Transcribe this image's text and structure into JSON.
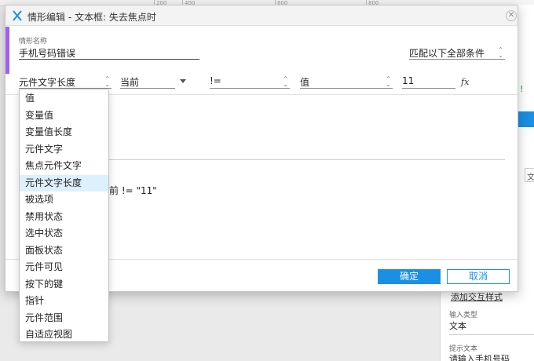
{
  "background": {
    "ruler_ticks": [
      "200",
      "400",
      "600",
      "800"
    ],
    "right_panel": {
      "link_text": "添加交互样式",
      "input_type_label": "输入类型",
      "input_type_value": "文本",
      "hint_label": "提示文本",
      "hint_value": "请输入手机号码",
      "partial_green_text": "!",
      "partial_tab_text": "文"
    }
  },
  "dialog": {
    "app_icon": "axure-logo-icon",
    "title": "情形编辑  -  文本框: 失去焦点时",
    "close_icon": "close-icon",
    "case_name_label": "情形名称",
    "case_name_value": "手机号码错误",
    "match_select_value": "匹配以下全部条件",
    "condition": {
      "target_value": "元件文字长度",
      "current_value": "当前",
      "operator_value": "!=",
      "type_value": "值",
      "value": "11",
      "fx_label": "fx"
    },
    "description_text": "前 != \"11\"",
    "ok_label": "确定",
    "cancel_label": "取消"
  },
  "dropdown": {
    "selected_index": 5,
    "items": [
      "值",
      "变量值",
      "变量值长度",
      "元件文字",
      "焦点元件文字",
      "元件文字长度",
      "被选项",
      "禁用状态",
      "选中状态",
      "面板状态",
      "元件可见",
      "按下的键",
      "指针",
      "元件范围",
      "自适应视图"
    ]
  },
  "colors": {
    "accent_purple": "#a15ef5",
    "primary_blue": "#1a8fe3",
    "selected_item_bg": "#dcf0fd",
    "green_text": "#27a844"
  }
}
